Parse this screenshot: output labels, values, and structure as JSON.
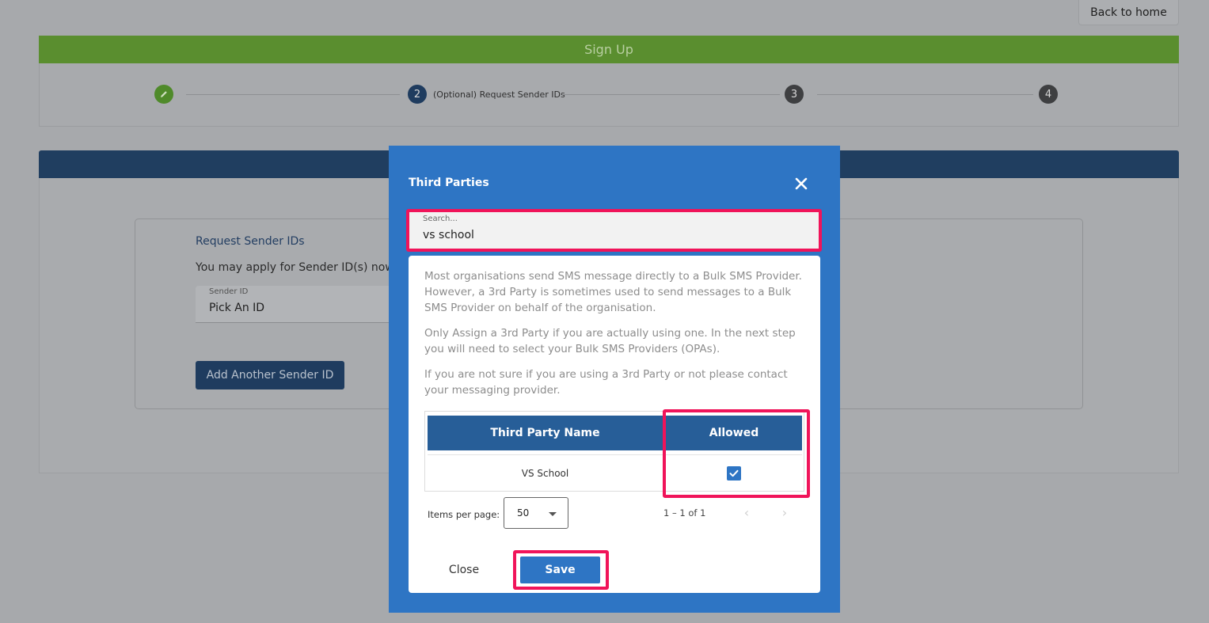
{
  "header": {
    "back_label": "Back to home",
    "signup_title": "Sign Up"
  },
  "stepper": {
    "steps": [
      {
        "label": "",
        "number": "",
        "state": "done"
      },
      {
        "label": "(Optional) Request Sender IDs",
        "number": "2",
        "state": "active"
      },
      {
        "label": "",
        "number": "3",
        "state": "pending"
      },
      {
        "label": "",
        "number": "4",
        "state": "pending"
      }
    ]
  },
  "background": {
    "section_title": "Request Sender IDs",
    "description": "You may apply for Sender ID(s) now o",
    "sender_field": {
      "label": "Sender ID",
      "value": "Pick An ID"
    },
    "add_button": "Add Another Sender ID"
  },
  "modal": {
    "title": "Third Parties",
    "search": {
      "placeholder": "Search...",
      "value": "vs school"
    },
    "paragraphs": [
      "Most organisations send SMS message directly to a Bulk SMS Provider. However, a 3rd Party is sometimes used to send messages to a Bulk SMS Provider on behalf of the organisation.",
      "Only Assign a 3rd Party if you are actually using one. In the next step you will need to select your Bulk SMS Providers (OPAs).",
      "If you are not sure if you are using a 3rd Party or not please contact your messaging provider."
    ],
    "table": {
      "columns": [
        "Third Party Name",
        "Allowed"
      ],
      "rows": [
        {
          "name": "VS School",
          "allowed": true
        }
      ]
    },
    "pagination": {
      "items_per_page_label": "Items per page:",
      "page_size": "50",
      "range": "1 – 1 of 1"
    },
    "close_label": "Close",
    "save_label": "Save"
  },
  "colors": {
    "primary_blue": "#2e75c4",
    "header_blue": "#275e98",
    "highlight": "#f0145a",
    "success_green": "#5a8e2f"
  }
}
